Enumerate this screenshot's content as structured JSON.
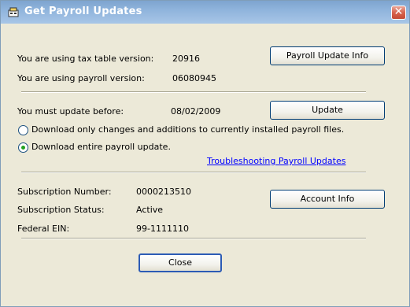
{
  "window": {
    "title": "Get Payroll Updates",
    "close_glyph": "✕"
  },
  "versions": {
    "tax_table_label": "You are using tax table version:",
    "tax_table_value": "20916",
    "payroll_label": "You are using payroll version:",
    "payroll_value": "06080945",
    "info_button": "Payroll Update Info"
  },
  "update": {
    "deadline_label": "You must update before:",
    "deadline_value": "08/02/2009",
    "update_button": "Update",
    "option_changes": "Download only changes and additions to currently installed payroll files.",
    "option_entire": "Download entire payroll update.",
    "selected_option": "entire",
    "troubleshoot_link": "Troubleshooting Payroll Updates"
  },
  "subscription": {
    "number_label": "Subscription Number:",
    "number_value": "0000213510",
    "status_label": "Subscription Status:",
    "status_value": "Active",
    "ein_label": "Federal EIN:",
    "ein_value": "99-1111110",
    "account_button": "Account Info"
  },
  "footer": {
    "close_button": "Close"
  },
  "colors": {
    "titlebar": "#8fb4dc",
    "dialog_bg": "#ece9d8",
    "link": "#0000ff",
    "close_red": "#d7644e"
  },
  "icons": {
    "title_icon": "payroll-app-icon"
  }
}
